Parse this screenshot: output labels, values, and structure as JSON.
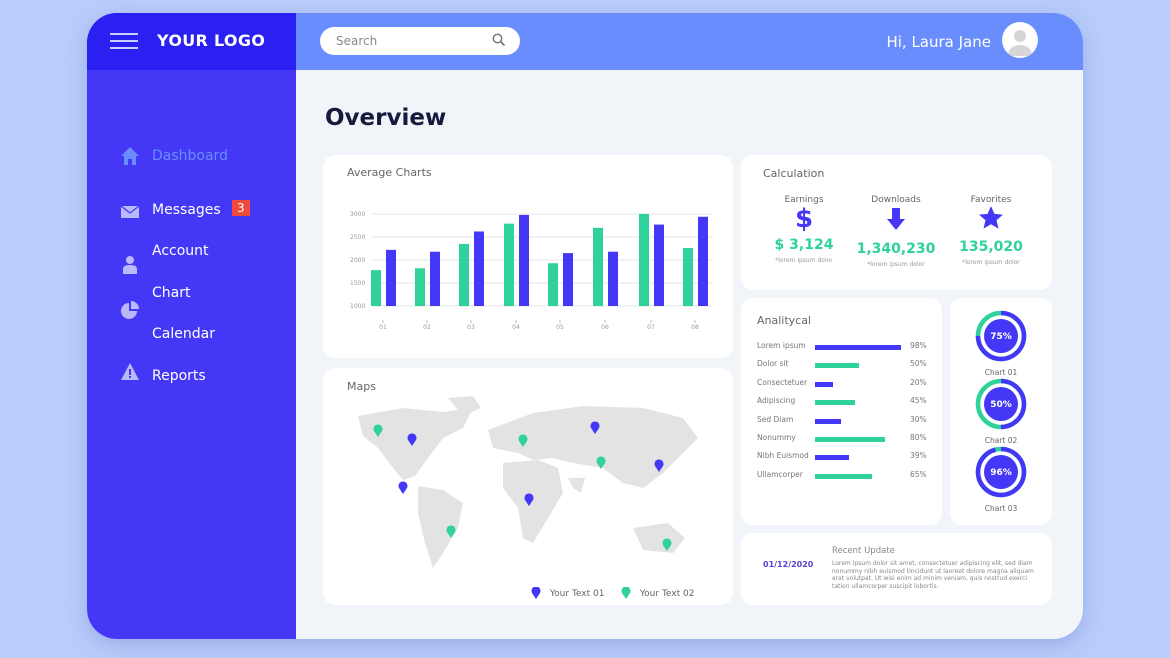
{
  "colors": {
    "accent_blue": "#4438f6",
    "accent_green": "#2fd29b",
    "logo_bar": "#2b20f2",
    "topbar": "#6a8dfd",
    "badge": "#f04a3a",
    "map_land": "#e3e3e3"
  },
  "header": {
    "logo": "YOUR LOGO",
    "search_placeholder": "Search",
    "greeting": "Hi, Laura Jane",
    "menu_icon": "hamburger-icon",
    "search_icon": "magnifier-icon",
    "avatar_icon": "user-avatar-icon"
  },
  "sidebar": {
    "items": [
      {
        "label": "Dashboard",
        "icon": "home-icon",
        "active": true
      },
      {
        "label": "Messages",
        "icon": "envelope-icon",
        "badge": "3"
      },
      {
        "label": "Account",
        "icon": "user-icon"
      },
      {
        "label": "Chart",
        "icon": "pie-chart-icon"
      },
      {
        "label": "Calendar"
      },
      {
        "label": "Reports",
        "icon": "warning-icon"
      }
    ]
  },
  "main": {
    "title": "Overview"
  },
  "chart_data": {
    "type": "bar",
    "title": "Average Charts",
    "categories": [
      "01",
      "02",
      "03",
      "04",
      "05",
      "06",
      "07",
      "08"
    ],
    "yticks": [
      "3000",
      "2500",
      "2000",
      "1500",
      "1000"
    ],
    "ylim": [
      1000,
      3000
    ],
    "grid": true,
    "series": [
      {
        "color": "#2fd29b",
        "values": [
          1780,
          1820,
          2350,
          2790,
          1930,
          2700,
          3000,
          2260
        ]
      },
      {
        "color": "#4438f6",
        "values": [
          2220,
          2180,
          2620,
          2980,
          2150,
          2180,
          2770,
          2940
        ]
      }
    ]
  },
  "maps": {
    "title": "Maps",
    "legend": [
      "Your Text 01",
      "Your Text 02"
    ]
  },
  "calculation": {
    "title": "Calculation",
    "stats": [
      {
        "label": "Earnings",
        "value": "$ 3,124",
        "note": "*lorem ipsum dolor",
        "icon": "dollar-icon"
      },
      {
        "label": "Downloads",
        "value": "1,340,230",
        "note": "*lorem ipsum dolor",
        "icon": "arrow-down-icon"
      },
      {
        "label": "Favorites",
        "value": "135,020",
        "note": "*lorem ipsum dolor",
        "icon": "star-icon"
      }
    ]
  },
  "analytical": {
    "title": "Analitycal",
    "rows": [
      {
        "label": "Lorem ipsum",
        "pct": 98,
        "pct_label": "98%",
        "color": "blue"
      },
      {
        "label": "Dolor sit",
        "pct": 50,
        "pct_label": "50%",
        "color": "green"
      },
      {
        "label": "Consectetuer",
        "pct": 20,
        "pct_label": "20%",
        "color": "blue"
      },
      {
        "label": "Adipiscing",
        "pct": 45,
        "pct_label": "45%",
        "color": "green"
      },
      {
        "label": "Sed Diam",
        "pct": 30,
        "pct_label": "30%",
        "color": "blue"
      },
      {
        "label": "Nonummy",
        "pct": 80,
        "pct_label": "80%",
        "color": "green"
      },
      {
        "label": "Nibh Euismod",
        "pct": 39,
        "pct_label": "39%",
        "color": "blue"
      },
      {
        "label": "Ullamcorper",
        "pct": 65,
        "pct_label": "65%",
        "color": "green"
      }
    ]
  },
  "donuts": [
    {
      "label": "Chart 01",
      "pct": 75,
      "pct_label": "75%"
    },
    {
      "label": "Chart 02",
      "pct": 50,
      "pct_label": "50%"
    },
    {
      "label": "Chart 03",
      "pct": 96,
      "pct_label": "96%"
    }
  ],
  "update": {
    "date": "01/12/2020",
    "title": "Recent Update",
    "text": "Lorem ipsum dolor sit amet, consectetuer adipiscing elit, sed diam nonummy nibh euismod tincidunt ut laoreet dolore magna aliquam erat volutpat. Ut wisi enim ad minim veniam, quis nostrud exerci tation ullamcorper suscipit lobortis."
  }
}
